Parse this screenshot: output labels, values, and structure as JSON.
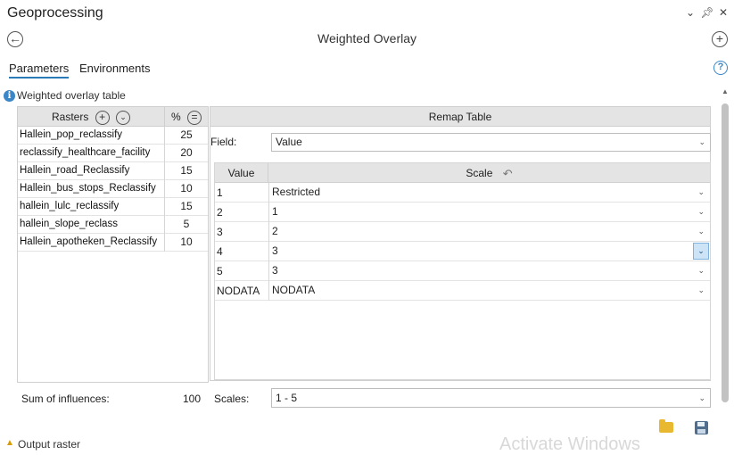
{
  "window": {
    "title": "Geoprocessing",
    "tool_title": "Weighted Overlay"
  },
  "tabs": [
    {
      "label": "Parameters",
      "active": true
    },
    {
      "label": "Environments",
      "active": false
    }
  ],
  "section": {
    "label": "Weighted overlay table"
  },
  "rasters_table": {
    "header_rasters": "Rasters",
    "header_percent": "%",
    "rows": [
      {
        "name": "Hallein_pop_reclassify",
        "percent": "25"
      },
      {
        "name": "reclassify_healthcare_facility",
        "percent": "20"
      },
      {
        "name": "Hallein_road_Reclassify",
        "percent": "15"
      },
      {
        "name": "Hallein_bus_stops_Reclassify",
        "percent": "10"
      },
      {
        "name": "hallein_lulc_reclassify",
        "percent": "15"
      },
      {
        "name": "hallein_slope_reclass",
        "percent": "5"
      },
      {
        "name": "Hallein_apotheken_Reclassify",
        "percent": "10"
      }
    ]
  },
  "remap": {
    "header": "Remap Table",
    "field_label": "Field:",
    "field_value": "Value",
    "col_value": "Value",
    "col_scale": "Scale",
    "rows": [
      {
        "value": "1",
        "scale": "Restricted"
      },
      {
        "value": "2",
        "scale": "1"
      },
      {
        "value": "3",
        "scale": "2"
      },
      {
        "value": "4",
        "scale": "3"
      },
      {
        "value": "5",
        "scale": "3"
      },
      {
        "value": "NODATA",
        "scale": "NODATA"
      }
    ]
  },
  "footer": {
    "sum_label": "Sum of influences:",
    "sum_value": "100",
    "scales_label": "Scales:",
    "scales_value": "1 - 5"
  },
  "bottom": {
    "text": "Output raster",
    "watermark": "Activate Windows"
  },
  "colors": {
    "accent": "#2a7ab8",
    "highlight": "#cde4f7"
  }
}
